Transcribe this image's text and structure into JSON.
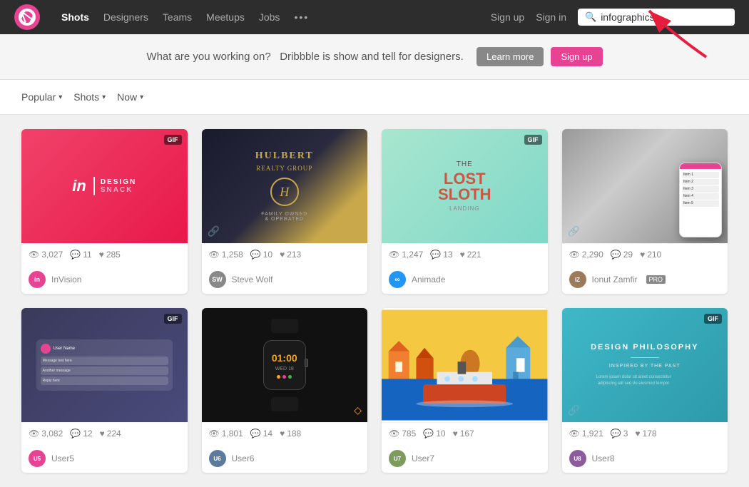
{
  "nav": {
    "logo_alt": "Dribbble",
    "links": [
      {
        "label": "Shots",
        "active": true
      },
      {
        "label": "Designers",
        "active": false
      },
      {
        "label": "Teams",
        "active": false
      },
      {
        "label": "Meetups",
        "active": false
      },
      {
        "label": "Jobs",
        "active": false
      }
    ],
    "more_label": "•••",
    "sign_up": "Sign up",
    "sign_in": "Sign in",
    "search_value": "infographics",
    "search_placeholder": "Search"
  },
  "banner": {
    "question": "What are you working on?",
    "tagline": "Dribbble is show and tell for designers.",
    "btn_learn": "Learn more",
    "btn_signup": "Sign up"
  },
  "filters": {
    "popular": "Popular",
    "shots": "Shots",
    "now": "Now"
  },
  "shots": [
    {
      "id": 1,
      "has_gif": true,
      "has_link": false,
      "thumb_type": "pink",
      "thumb_content": "InVision | Design Snack",
      "views": "3,027",
      "comments": "11",
      "likes": "285",
      "author_avatar_type": "invision",
      "author_avatar_letter": "in",
      "author_name": "InVision",
      "is_pro": false
    },
    {
      "id": 2,
      "has_gif": false,
      "has_link": true,
      "thumb_type": "dark",
      "thumb_content": "Hulbert Realty Group",
      "views": "1,258",
      "comments": "10",
      "likes": "213",
      "author_avatar_type": "stevewolf",
      "author_avatar_letter": "SW",
      "author_name": "Steve Wolf",
      "is_pro": false
    },
    {
      "id": 3,
      "has_gif": true,
      "has_link": false,
      "thumb_type": "mint",
      "thumb_content": "The Lost Sloth Landing",
      "views": "1,247",
      "comments": "13",
      "likes": "221",
      "author_avatar_type": "animade",
      "author_avatar_letter": "∞",
      "author_name": "Animade",
      "is_pro": false
    },
    {
      "id": 4,
      "has_gif": false,
      "has_link": true,
      "thumb_type": "phone",
      "thumb_content": "Phone mockup",
      "views": "2,290",
      "comments": "29",
      "likes": "210",
      "author_avatar_type": "ionut",
      "author_avatar_letter": "IZ",
      "author_name": "Ionut Zamfir",
      "is_pro": true
    },
    {
      "id": 5,
      "has_gif": true,
      "has_link": false,
      "thumb_type": "bluedark",
      "thumb_content": "Chat UI",
      "views": "3,082",
      "comments": "12",
      "likes": "224",
      "author_avatar_type": "user5",
      "author_avatar_letter": "U",
      "author_name": "User5",
      "is_pro": false
    },
    {
      "id": 6,
      "has_gif": false,
      "has_link": false,
      "thumb_type": "applewatch",
      "thumb_content": "Apple Watch App",
      "views": "1,801",
      "comments": "14",
      "likes": "188",
      "author_avatar_type": "user6",
      "author_avatar_letter": "U",
      "author_name": "User6",
      "is_pro": false
    },
    {
      "id": 7,
      "has_gif": false,
      "has_link": false,
      "thumb_type": "ship",
      "thumb_content": "Ship Illustration",
      "views": "785",
      "comments": "10",
      "likes": "167",
      "author_avatar_type": "user7",
      "author_avatar_letter": "U",
      "author_name": "User7",
      "is_pro": false
    },
    {
      "id": 8,
      "has_gif": true,
      "has_link": true,
      "thumb_type": "teal",
      "thumb_content": "Design Philosophy",
      "views": "1,921",
      "comments": "3",
      "likes": "178",
      "author_avatar_type": "user8",
      "author_avatar_letter": "U",
      "author_name": "User8",
      "is_pro": false
    }
  ]
}
